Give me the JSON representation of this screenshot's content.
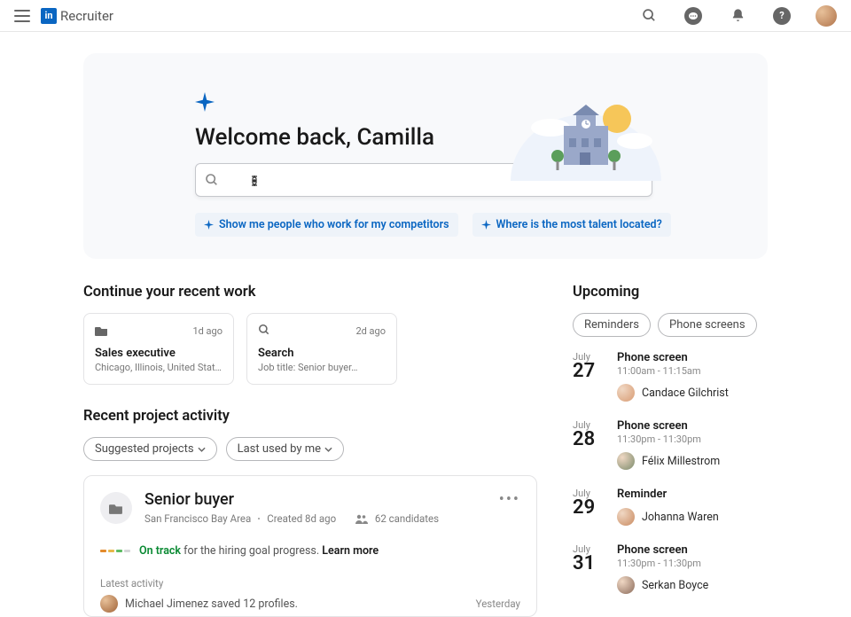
{
  "header": {
    "brand": "Recruiter"
  },
  "hero": {
    "title": "Welcome back, Camilla",
    "search_value": "",
    "search_placeholder": "",
    "chips": [
      {
        "label": "Show me people who work for my competitors"
      },
      {
        "label": "Where is the most talent located?"
      }
    ]
  },
  "recent_work": {
    "title": "Continue your recent work",
    "cards": [
      {
        "icon": "folder",
        "ago": "1d ago",
        "title": "Sales executive",
        "sub": "Chicago, Illinois, United States · Jere…"
      },
      {
        "icon": "search",
        "ago": "2d ago",
        "title": "Search",
        "sub": "Job title: Senior buyer…"
      }
    ]
  },
  "recent_activity": {
    "title": "Recent project activity",
    "filter_pills": [
      {
        "label": "Suggested projects"
      },
      {
        "label": "Last used by me"
      }
    ],
    "project": {
      "title": "Senior buyer",
      "location": "San Francisco Bay Area",
      "created": "Created 8d ago",
      "candidates": "62 candidates",
      "status_label": "On track",
      "status_rest": " for the hiring goal progress. ",
      "learn_more": "Learn more",
      "latest_label": "Latest activity",
      "latest_text": "Michael Jimenez saved 12 profiles.",
      "latest_when": "Yesterday"
    }
  },
  "upcoming": {
    "title": "Upcoming",
    "pills": [
      {
        "label": "Reminders"
      },
      {
        "label": "Phone screens"
      }
    ],
    "items": [
      {
        "month": "July",
        "day": "27",
        "kind": "Phone screen",
        "time": "11:00am - 11:15am",
        "person": "Candace Gilchrist",
        "avatar": "#d89b73"
      },
      {
        "month": "July",
        "day": "28",
        "kind": "Phone screen",
        "time": "11:30pm - 11:30pm",
        "person": "Félix Millestrom",
        "avatar": "#7a8a6a"
      },
      {
        "month": "July",
        "day": "29",
        "kind": "Reminder",
        "time": "",
        "person": "Johanna Waren",
        "avatar": "#c98a60"
      },
      {
        "month": "July",
        "day": "31",
        "kind": "Phone screen",
        "time": "11:30pm - 11:30pm",
        "person": "Serkan Boyce",
        "avatar": "#8a6a5a"
      }
    ]
  }
}
